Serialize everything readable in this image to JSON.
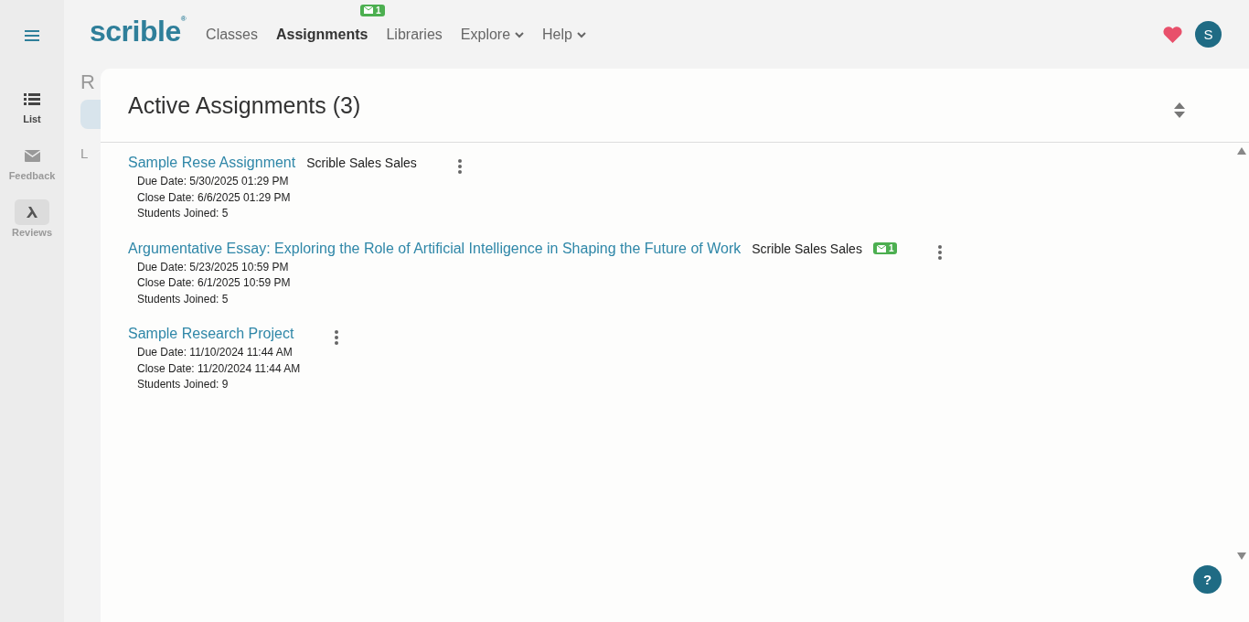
{
  "sidebar": {
    "items": [
      {
        "label": "List",
        "selected": true,
        "highlighted": false
      },
      {
        "label": "Feedback",
        "selected": false,
        "highlighted": false
      },
      {
        "label": "Reviews",
        "selected": false,
        "highlighted": true
      }
    ]
  },
  "topbar": {
    "logo": "scrible",
    "logo_mark": "®",
    "nav": [
      {
        "label": "Classes",
        "selected": false,
        "dropdown": false
      },
      {
        "label": "Assignments",
        "selected": true,
        "dropdown": false,
        "badge": "1"
      },
      {
        "label": "Libraries",
        "selected": false,
        "dropdown": false
      },
      {
        "label": "Explore",
        "selected": false,
        "dropdown": true
      },
      {
        "label": "Help",
        "selected": false,
        "dropdown": true
      }
    ],
    "avatar": "S"
  },
  "background_panel": {
    "heading": "R",
    "item": "L"
  },
  "main": {
    "title": "Active Assignments (3)",
    "assignments": [
      {
        "name": "Sample Rese Assignment",
        "owner": "Scrible Sales Sales",
        "due": "Due Date: 5/30/2025 01:29 PM",
        "close": "Close Date: 6/6/2025 01:29 PM",
        "joined": "Students Joined: 5"
      },
      {
        "name": "Argumentative Essay: Exploring the Role of Artificial Intelligence in Shaping the Future of Work",
        "owner": "Scrible Sales Sales",
        "badge": "1",
        "due": "Due Date: 5/23/2025 10:59 PM",
        "close": "Close Date: 6/1/2025 10:59 PM",
        "joined": "Students Joined: 5"
      },
      {
        "name": "Sample Research Project",
        "due": "Due Date: 11/10/2024 11:44 AM",
        "close": "Close Date: 11/20/2024 11:44 AM",
        "joined": "Students Joined: 9"
      }
    ]
  },
  "help_button": "?"
}
